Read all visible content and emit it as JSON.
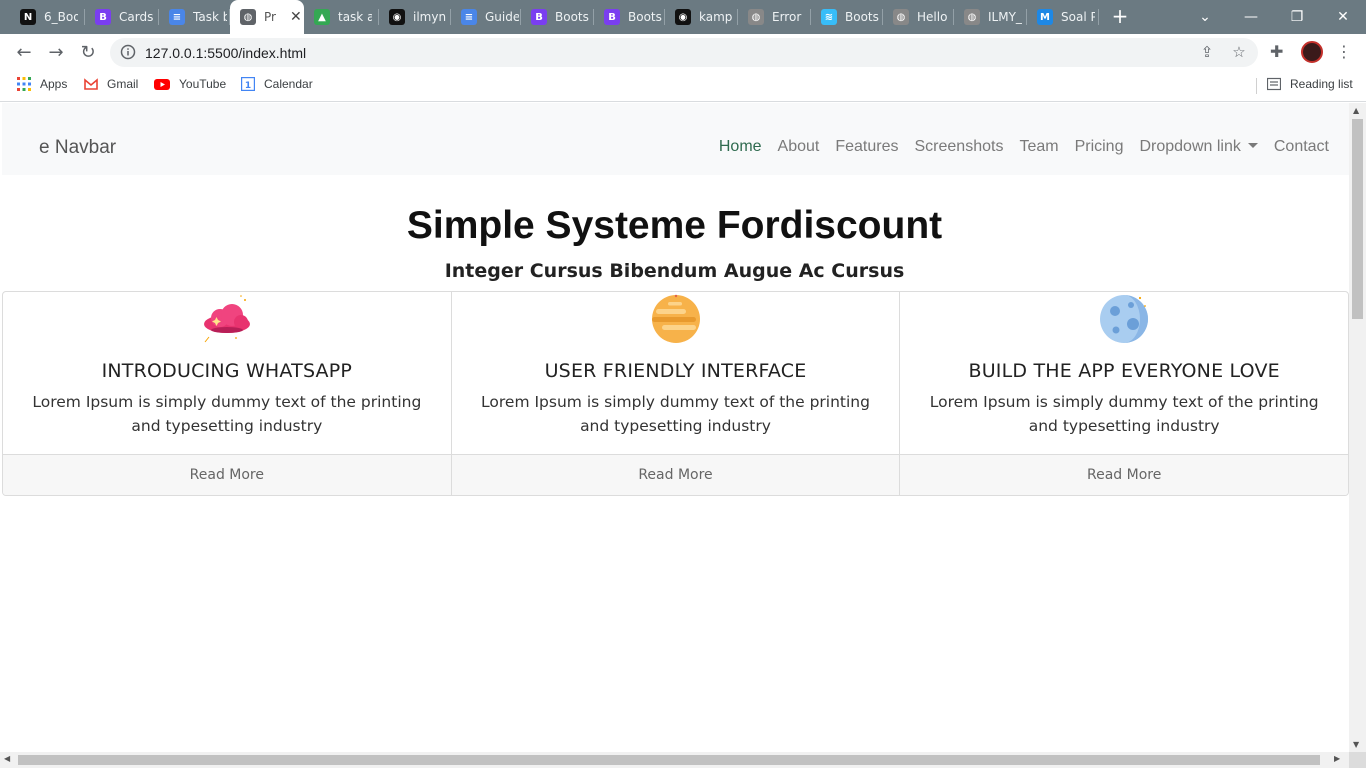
{
  "browser": {
    "tabs": [
      {
        "title": "6_Boo",
        "favicon": "N",
        "color": "#111111"
      },
      {
        "title": "Cards",
        "favicon": "B",
        "color": "#7a3ef0"
      },
      {
        "title": "Task b",
        "favicon": "≡",
        "color": "#4a86e8"
      },
      {
        "title": "Pr",
        "favicon": "◍",
        "color": "#5f6368"
      },
      {
        "title": "task a",
        "favicon": "▲",
        "color": "#34a853"
      },
      {
        "title": "ilmyn",
        "favicon": "◉",
        "color": "#111111"
      },
      {
        "title": "Guide",
        "favicon": "≡",
        "color": "#4a86e8"
      },
      {
        "title": "Boots",
        "favicon": "B",
        "color": "#7a3ef0"
      },
      {
        "title": "Boots",
        "favicon": "B",
        "color": "#7a3ef0"
      },
      {
        "title": "kamp",
        "favicon": "◉",
        "color": "#111111"
      },
      {
        "title": "Error",
        "favicon": "◍",
        "color": "#888888"
      },
      {
        "title": "Boots",
        "favicon": "≋",
        "color": "#38bdf8"
      },
      {
        "title": "Hello",
        "favicon": "◍",
        "color": "#888888"
      },
      {
        "title": "ILMY_",
        "favicon": "◍",
        "color": "#888888"
      },
      {
        "title": "Soal P",
        "favicon": "M",
        "color": "#1e88e5"
      }
    ],
    "active_tab_index": 3,
    "url": "127.0.0.1:5500/index.html",
    "bookmarks": [
      {
        "label": "Apps",
        "icon": "apps-grid-icon"
      },
      {
        "label": "Gmail",
        "icon": "gmail-icon"
      },
      {
        "label": "YouTube",
        "icon": "youtube-icon"
      },
      {
        "label": "Calendar",
        "icon": "calendar-icon"
      }
    ],
    "reading_list": "Reading list"
  },
  "navbar": {
    "brand": "e Navbar",
    "links": [
      {
        "label": "Home",
        "active": true
      },
      {
        "label": "About"
      },
      {
        "label": "Features"
      },
      {
        "label": "Screenshots"
      },
      {
        "label": "Team"
      },
      {
        "label": "Pricing"
      },
      {
        "label": "Dropdown link",
        "dropdown": true
      },
      {
        "label": "Contact"
      }
    ]
  },
  "hero": {
    "title": "Simple Systeme Fordiscount",
    "subtitle": "Integer Cursus Bibendum Augue Ac Cursus"
  },
  "cards": [
    {
      "title": "INTRODUCING WHATSAPP",
      "text": "Lorem Ipsum is simply dummy text of the printing and typesetting industry",
      "footer": "Read More",
      "icon": "pink-cloud-icon"
    },
    {
      "title": "USER FRIENDLY INTERFACE",
      "text": "Lorem Ipsum is simply dummy text of the printing and typesetting industry",
      "footer": "Read More",
      "icon": "orange-planet-icon"
    },
    {
      "title": "BUILD THE APP EVERYONE LOVE",
      "text": "Lorem Ipsum is simply dummy text of the printing and typesetting industry",
      "footer": "Read More",
      "icon": "blue-moon-icon"
    }
  ]
}
